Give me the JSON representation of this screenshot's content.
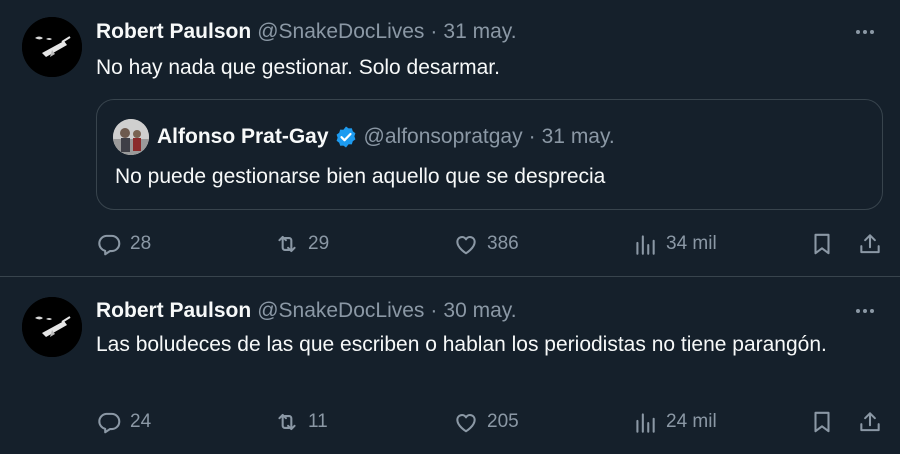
{
  "tweets": [
    {
      "author": "Robert Paulson",
      "handle": "@SnakeDocLives",
      "separator": "·",
      "date": "31 may.",
      "text": "No hay nada que gestionar. Solo desarmar.",
      "quote": {
        "author": "Alfonso Prat-Gay",
        "handle": "@alfonsopratgay",
        "separator": "·",
        "date": "31 may.",
        "text": "No puede gestionarse bien aquello que se desprecia"
      },
      "replies": "28",
      "retweets": "29",
      "likes": "386",
      "views": "34 mil"
    },
    {
      "author": "Robert Paulson",
      "handle": "@SnakeDocLives",
      "separator": "·",
      "date": "30 may.",
      "text": "Las boludeces de las que escriben o hablan los periodistas no tiene parangón.",
      "replies": "24",
      "retweets": "11",
      "likes": "205",
      "views": "24 mil"
    }
  ],
  "colors": {
    "background": "#15202b",
    "text_primary": "#f7f9f9",
    "text_secondary": "#8b98a5",
    "border": "#38444d",
    "verified": "#1d9bf0"
  },
  "icons": {
    "reply": "reply-icon",
    "retweet": "retweet-icon",
    "like": "heart-icon",
    "views": "views-chart-icon",
    "bookmark": "bookmark-icon",
    "share": "share-icon",
    "more": "more-dots-icon",
    "verified": "verified-badge-icon"
  }
}
